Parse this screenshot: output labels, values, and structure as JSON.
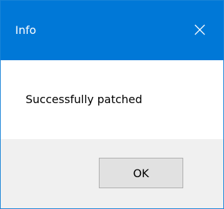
{
  "dialog": {
    "title": "Info",
    "message": "Successfully patched",
    "ok_label": "OK"
  },
  "icons": {
    "close": "close-icon"
  },
  "colors": {
    "titlebar": "#0078d7",
    "footer": "#f0f0f0",
    "button": "#e1e1e1"
  }
}
